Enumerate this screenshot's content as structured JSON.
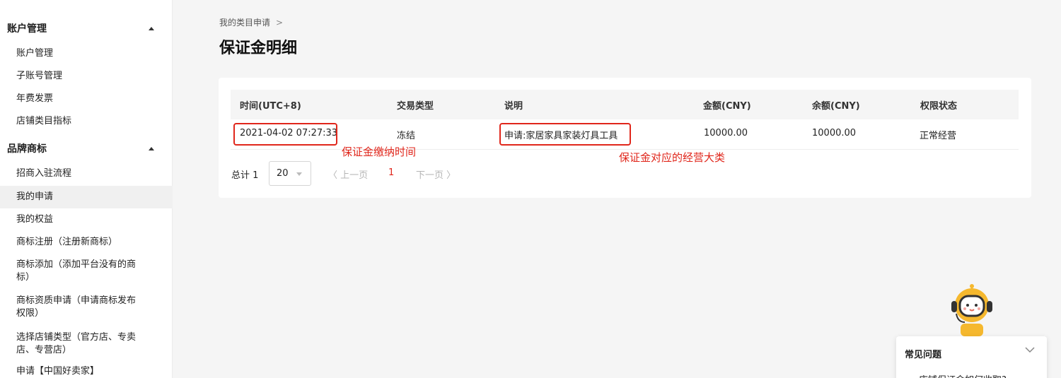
{
  "sidebar": {
    "groups": [
      {
        "title": "账户管理",
        "items": [
          "账户管理",
          "子账号管理",
          "年费发票",
          "店铺类目指标"
        ]
      },
      {
        "title": "品牌商标",
        "items": [
          "招商入驻流程",
          "我的申请",
          "我的权益",
          "商标注册（注册新商标）",
          "商标添加（添加平台没有的商标）",
          "商标资质申请（申请商标发布权限）",
          "选择店铺类型（官方店、专卖店、专营店）",
          "申请【中国好卖家】"
        ]
      }
    ]
  },
  "breadcrumb": {
    "text": "我的类目申请",
    "sep": ">"
  },
  "page": {
    "title": "保证金明细"
  },
  "table": {
    "headers": [
      "时间(UTC+8)",
      "交易类型",
      "说明",
      "金额(CNY)",
      "余额(CNY)",
      "权限状态"
    ],
    "rows": [
      [
        "2021-04-02 07:27:33",
        "冻结",
        "申请:家居家具家装灯具工具",
        "10000.00",
        "10000.00",
        "正常经营"
      ]
    ]
  },
  "annotations": {
    "time": "保证金缴纳时间",
    "category": "保证金对应的经营大类"
  },
  "pagination": {
    "total_label": "总计 1",
    "page_size": "20",
    "prev": "〈 上一页",
    "current": "1",
    "next": "下一页 〉"
  },
  "faq": {
    "title": "常见问题",
    "first_item": "店铺保证金如何收取?"
  },
  "colors": {
    "accent": "#e0261b",
    "background": "#f5f5f5"
  }
}
